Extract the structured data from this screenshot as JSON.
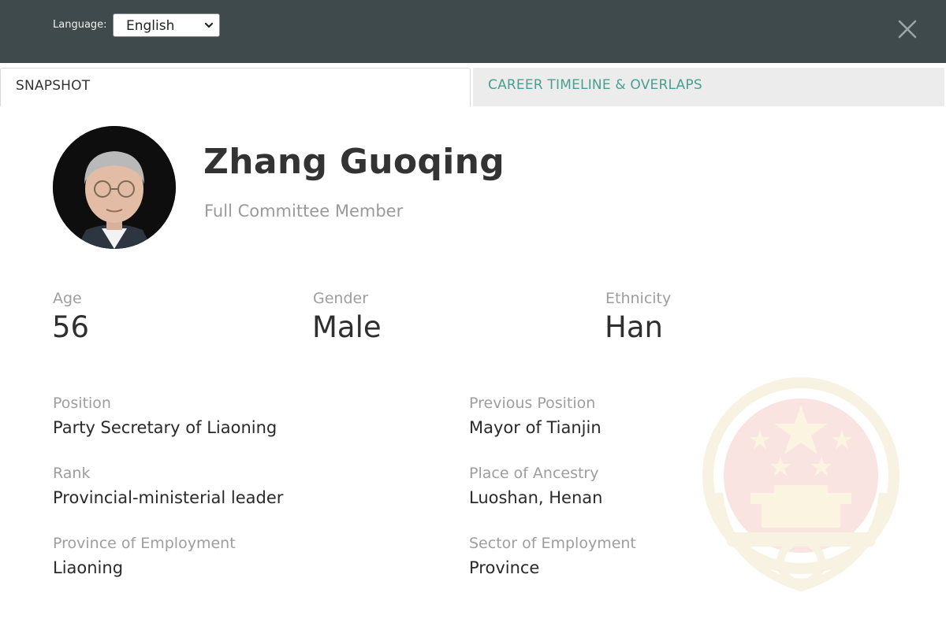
{
  "header": {
    "language_label": "Language:",
    "language_value": "English",
    "icons": {
      "dropdown": "chevron-down-icon",
      "close": "close-icon"
    }
  },
  "tabs": [
    {
      "label": "SNAPSHOT",
      "active": true
    },
    {
      "label": "CAREER TIMELINE & OVERLAPS",
      "active": false
    }
  ],
  "profile": {
    "name": "Zhang Guoqing",
    "subtitle": "Full Committee Member",
    "stats": {
      "age_label": "Age",
      "age_value": "56",
      "gender_label": "Gender",
      "gender_value": "Male",
      "ethnicity_label": "Ethnicity",
      "ethnicity_value": "Han"
    },
    "details": {
      "position_label": "Position",
      "position_value": "Party Secretary of Liaoning",
      "previous_label": "Previous Position",
      "previous_value": "Mayor of Tianjin",
      "rank_label": "Rank",
      "rank_value": "Provincial-ministerial leader",
      "ancestry_label": "Place of Ancestry",
      "ancestry_value": "Luoshan, Henan",
      "province_label": "Province of Employment",
      "province_value": "Liaoning",
      "sector_label": "Sector of Employment",
      "sector_value": "Province"
    }
  },
  "colors": {
    "header_bg": "#3f4a4d",
    "tab_accent": "#4a9f90",
    "label_gray": "#9e9e9e"
  }
}
